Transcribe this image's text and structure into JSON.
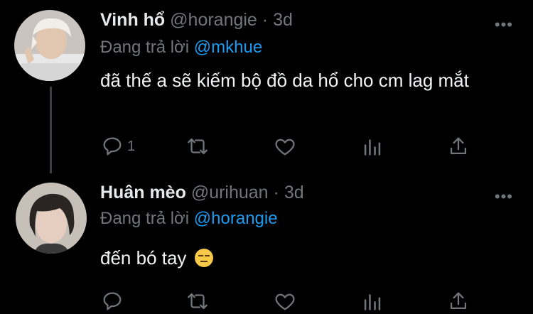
{
  "tweets": [
    {
      "name": "Vinh hổ",
      "handle": "@horangie",
      "dot": "·",
      "time": "3d",
      "replying_prefix": "Đang trả lời",
      "replying_to": "@mkhue",
      "text": "đã thế a sẽ kiếm bộ đồ da hổ cho cm lag mắt",
      "replies": "1",
      "more": "•••"
    },
    {
      "name": "Huân mèo",
      "handle": "@urihuan",
      "dot": "·",
      "time": "3d",
      "replying_prefix": "Đang trả lời",
      "replying_to": "@horangie",
      "text": "đến bó tay",
      "emoji": "expressionless-face",
      "more": "•••"
    }
  ],
  "colors": {
    "background": "#000000",
    "text": "#e7e9ea",
    "muted": "#71767b",
    "link": "#1d9bf0"
  },
  "icons": [
    "reply-icon",
    "retweet-icon",
    "like-icon",
    "analytics-icon",
    "share-icon"
  ]
}
